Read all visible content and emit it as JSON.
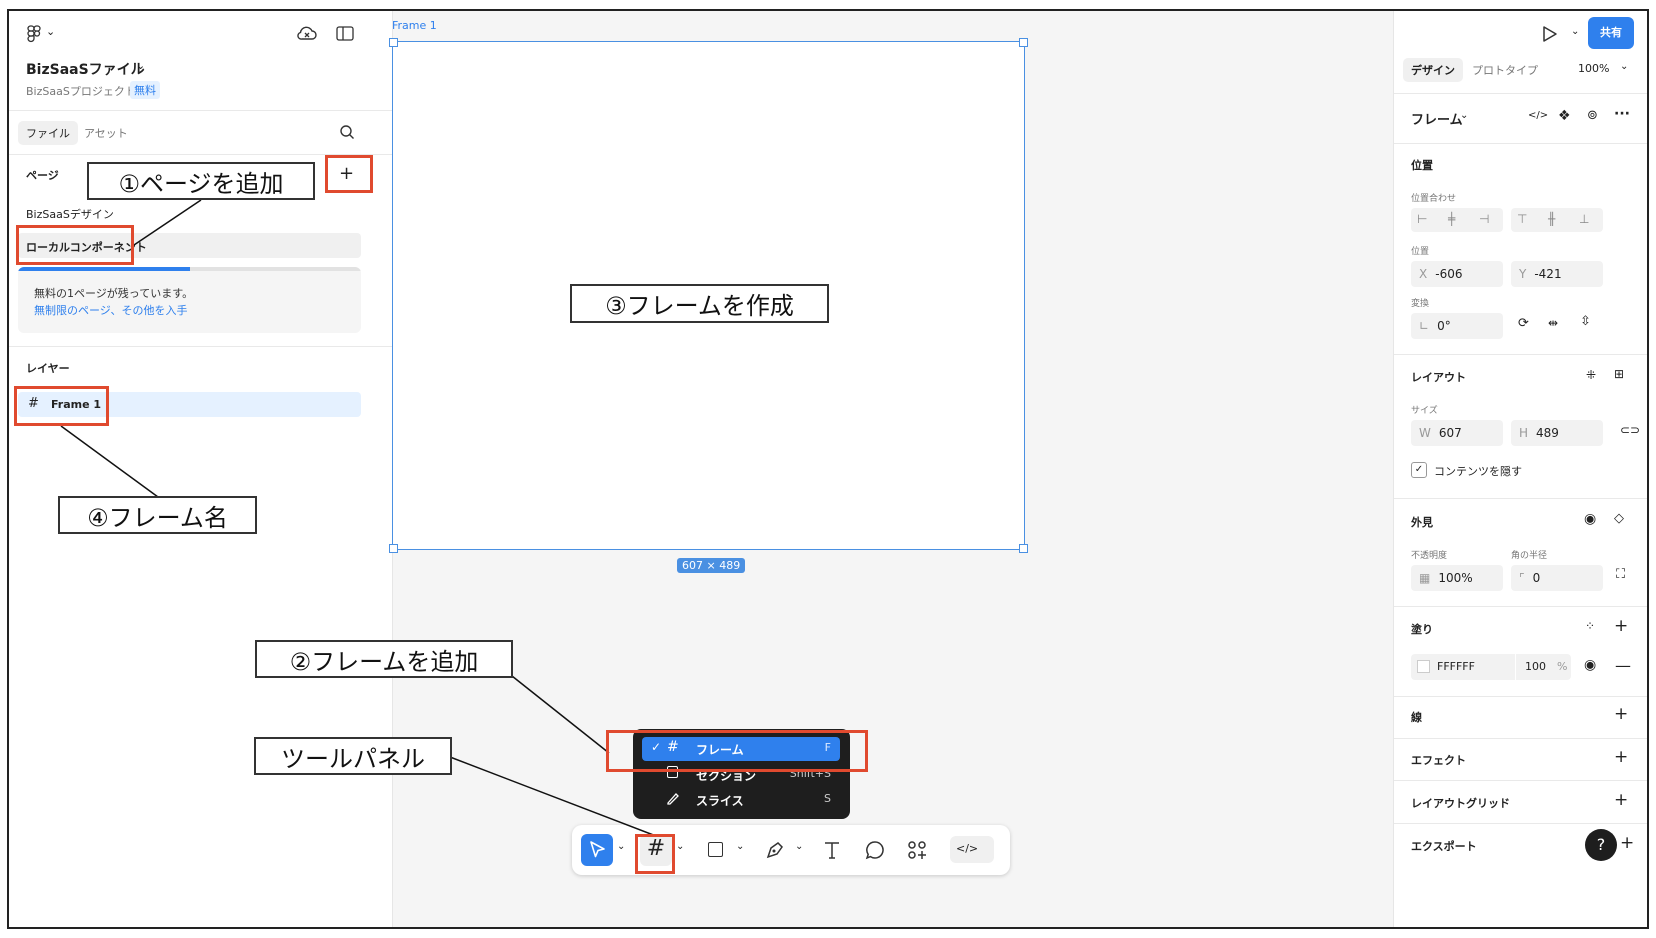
{
  "file": {
    "name": "BizSaaSファイル",
    "project": "BizSaaSプロジェクト",
    "plan_badge": "無料"
  },
  "left_tabs": {
    "file": "ファイル",
    "assets": "アセット"
  },
  "pages": {
    "heading": "ページ",
    "items": [
      "BizSaaSデザイン",
      "ローカルコンポーネント"
    ],
    "notice_line1": "無料の1ページが残っています。",
    "notice_link": "無制限のページ、その他を入手",
    "free_pages_used_fraction": 0.5
  },
  "layers": {
    "heading": "レイヤー",
    "items": [
      {
        "name": "Frame 1"
      }
    ]
  },
  "canvas": {
    "frame_label": "Frame 1",
    "size_badge": "607 × 489"
  },
  "frame_menu": {
    "items": [
      {
        "label": "フレーム",
        "shortcut": "F",
        "selected": true
      },
      {
        "label": "セクション",
        "shortcut": "Shift+S",
        "selected": false
      },
      {
        "label": "スライス",
        "shortcut": "S",
        "selected": false
      }
    ]
  },
  "right_panel": {
    "share": "共有",
    "tabs": {
      "design": "デザイン",
      "prototype": "プロトタイプ"
    },
    "zoom": "100%",
    "frame_type": "フレーム",
    "position": {
      "heading": "位置",
      "align_label": "位置合わせ",
      "pos_label": "位置",
      "x_label": "X",
      "x": "-606",
      "y_label": "Y",
      "y": "-421",
      "transform_label": "変換",
      "rotation": "0°"
    },
    "layout": {
      "heading": "レイアウト",
      "size_label": "サイズ",
      "w_label": "W",
      "w": "607",
      "h_label": "H",
      "h": "489",
      "clip_label": "コンテンツを隠す",
      "clip": true
    },
    "appearance": {
      "heading": "外見",
      "opacity_label": "不透明度",
      "opacity": "100%",
      "radius_label": "角の半径",
      "radius": "0"
    },
    "fill": {
      "heading": "塗り",
      "hex": "FFFFFF",
      "opacity": "100",
      "unit": "%"
    },
    "stroke": "線",
    "effects": "エフェクト",
    "layout_grid": "レイアウトグリッド",
    "export": "エクスポート",
    "help": "?"
  },
  "callouts": {
    "add_page": "①ページを追加",
    "add_frame": "②フレームを追加",
    "create_frame": "③フレームを作成",
    "frame_name": "④フレーム名",
    "tool_panel": "ツールパネル"
  },
  "colors": {
    "accent": "#2f80ed",
    "highlight": "#e04a2f",
    "selection_bg": "#e5f1ff"
  }
}
